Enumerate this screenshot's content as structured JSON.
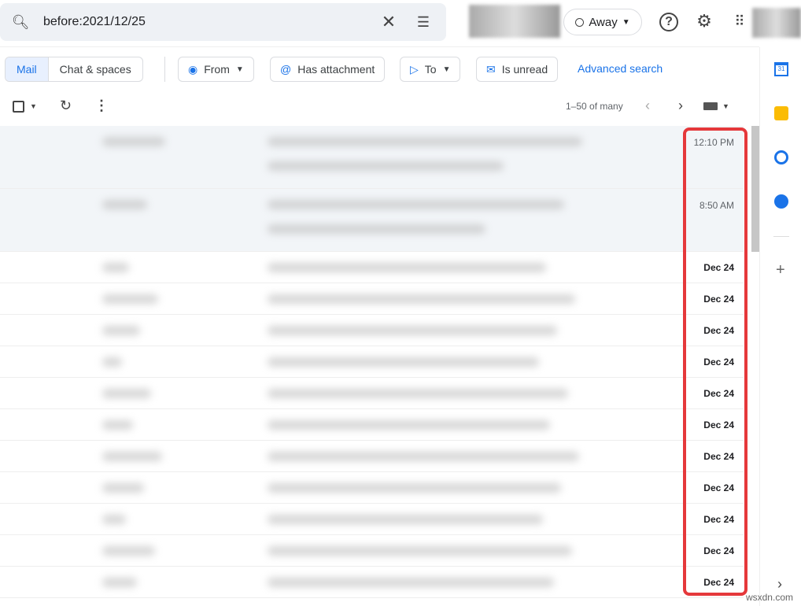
{
  "search": {
    "query": "before:2021/12/25"
  },
  "header": {
    "status": "Away"
  },
  "filters": {
    "tabs": [
      "Mail",
      "Chat & spaces"
    ],
    "chips": [
      "From",
      "Has attachment",
      "To",
      "Is unread"
    ],
    "advanced": "Advanced search"
  },
  "toolbar": {
    "pagination": "1–50 of many"
  },
  "emails": [
    {
      "date": "12:10 PM",
      "unread": false
    },
    {
      "date": "8:50 AM",
      "unread": false
    },
    {
      "date": "Dec 24",
      "unread": true
    },
    {
      "date": "Dec 24",
      "unread": true
    },
    {
      "date": "Dec 24",
      "unread": true
    },
    {
      "date": "Dec 24",
      "unread": true
    },
    {
      "date": "Dec 24",
      "unread": true
    },
    {
      "date": "Dec 24",
      "unread": true
    },
    {
      "date": "Dec 24",
      "unread": true
    },
    {
      "date": "Dec 24",
      "unread": true
    },
    {
      "date": "Dec 24",
      "unread": true
    },
    {
      "date": "Dec 24",
      "unread": true
    },
    {
      "date": "Dec 24",
      "unread": true
    }
  ],
  "colors": {
    "accent": "#1a73e8",
    "highlight": "#e5383b"
  },
  "watermark": "wsxdn.com"
}
